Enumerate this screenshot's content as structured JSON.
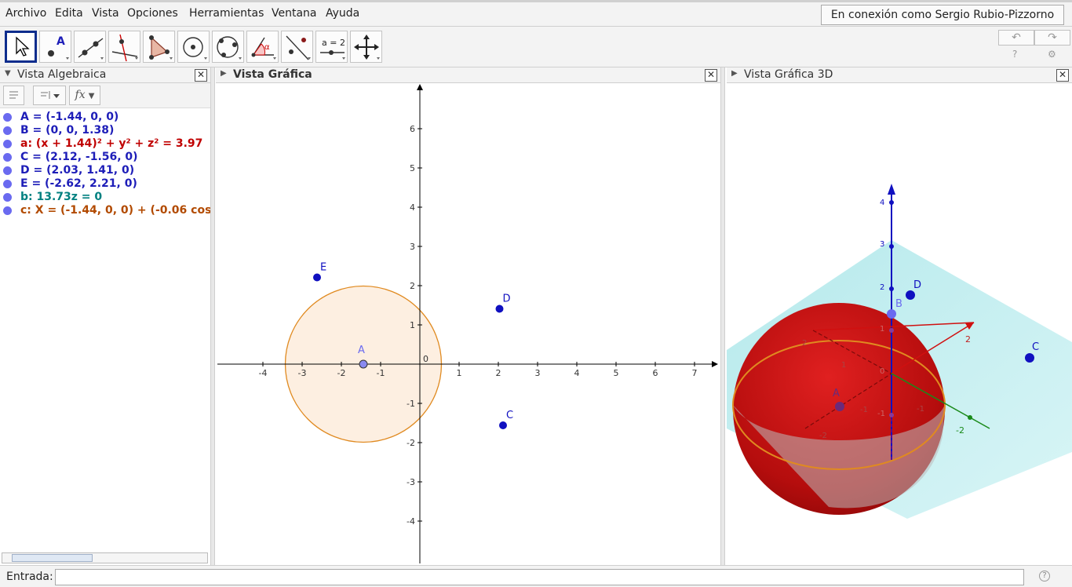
{
  "menu": {
    "items": [
      "Archivo",
      "Edita",
      "Vista",
      "Opciones",
      "Herramientas",
      "Ventana",
      "Ayuda"
    ],
    "login_status": "En conexión como Sergio Rubio-Pizzorno"
  },
  "toolbar": {
    "tools": [
      "move-tool",
      "point-tool",
      "line-tool",
      "perpendicular-tool",
      "polygon-tool",
      "circle-center-tool",
      "circle-three-points-tool",
      "angle-tool",
      "reflect-tool",
      "slider-tool",
      "move-view-tool"
    ],
    "point_label": "A",
    "slider_label": "a = 2",
    "angle_label": "α",
    "undo": "↶",
    "redo": "↷",
    "help": "?",
    "settings": "⚙"
  },
  "algebra": {
    "title": "Vista Algebraica",
    "fx_label": "fx",
    "rows": [
      {
        "text": "A = (-1.44, 0, 0)",
        "color": "#1d1db8"
      },
      {
        "text": "B = (0, 0, 1.38)",
        "color": "#1d1db8"
      },
      {
        "text": "a: (x + 1.44)² + y² + z² = 3.97",
        "color": "#c00000"
      },
      {
        "text": "C = (2.12, -1.56, 0)",
        "color": "#1d1db8"
      },
      {
        "text": "D = (2.03, 1.41, 0)",
        "color": "#1d1db8"
      },
      {
        "text": "E = (-2.62, 2.21, 0)",
        "color": "#1d1db8"
      },
      {
        "text": "b: 13.73z = 0",
        "color": "#008080"
      },
      {
        "text": "c: X = (-1.44, 0, 0) + (-0.06 cos",
        "color": "#b24a00"
      }
    ]
  },
  "graphics": {
    "title": "Vista Gráfica",
    "x_ticks": [
      "-4",
      "-3",
      "-2",
      "-1",
      "0",
      "1",
      "2",
      "3",
      "4",
      "5",
      "6",
      "7"
    ],
    "y_ticks": [
      "6",
      "5",
      "4",
      "3",
      "2",
      "1",
      "-1",
      "-2",
      "-3",
      "-4"
    ],
    "points": [
      {
        "label": "A",
        "x": -1.44,
        "y": 0
      },
      {
        "label": "C",
        "x": 2.12,
        "y": -1.56
      },
      {
        "label": "D",
        "x": 2.03,
        "y": 1.41
      },
      {
        "label": "E",
        "x": -2.62,
        "y": 2.21
      }
    ],
    "circle": {
      "cx": -1.44,
      "cy": 0,
      "r": 1.99
    },
    "colors": {
      "point": "#1010c0",
      "circle": "#e08a20",
      "circle_fill": "#fdebd9"
    }
  },
  "graphics3d": {
    "title": "Vista Gráfica 3D",
    "z_ticks": [
      "4",
      "3",
      "2",
      "1",
      "0",
      "-1"
    ],
    "axis_labels": [
      "2",
      "1",
      "-1",
      "2",
      "-2",
      "-1",
      "-2"
    ],
    "point_labels": [
      "D",
      "B",
      "C",
      "A"
    ]
  },
  "input": {
    "label": "Entrada:",
    "value": "",
    "help": "?"
  }
}
